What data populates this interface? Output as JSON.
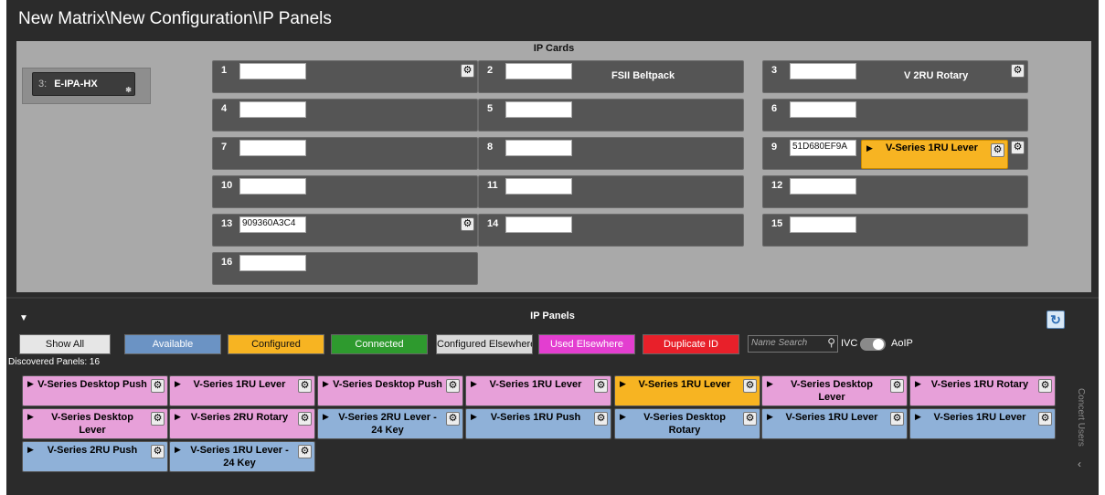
{
  "window": {
    "title": "New Matrix\\New Configuration\\IP Panels"
  },
  "ip_cards": {
    "label": "IP Cards",
    "chassis": {
      "index": "3:",
      "name": "E-IPA-HX"
    },
    "slots": [
      {
        "num": "1",
        "value": "",
        "gear": true,
        "panel_type": ""
      },
      {
        "num": "2",
        "value": "",
        "gear": false,
        "panel_type": "FSII Beltpack"
      },
      {
        "num": "3",
        "value": "",
        "gear": true,
        "panel_type": "V 2RU Rotary"
      },
      {
        "num": "4",
        "value": "",
        "gear": false,
        "panel_type": ""
      },
      {
        "num": "5",
        "value": "",
        "gear": false,
        "panel_type": ""
      },
      {
        "num": "6",
        "value": "",
        "gear": false,
        "panel_type": ""
      },
      {
        "num": "7",
        "value": "",
        "gear": false,
        "panel_type": ""
      },
      {
        "num": "8",
        "value": "",
        "gear": false,
        "panel_type": ""
      },
      {
        "num": "9",
        "value": "51D680EF9A",
        "gear": true,
        "panel_type": "",
        "assigned": {
          "label": "V-Series 1RU Lever",
          "color": "#f7b422"
        }
      },
      {
        "num": "10",
        "value": "",
        "gear": false,
        "panel_type": ""
      },
      {
        "num": "11",
        "value": "",
        "gear": false,
        "panel_type": ""
      },
      {
        "num": "12",
        "value": "",
        "gear": false,
        "panel_type": ""
      },
      {
        "num": "13",
        "value": "909360A3C4",
        "gear": true,
        "panel_type": ""
      },
      {
        "num": "14",
        "value": "",
        "gear": false,
        "panel_type": ""
      },
      {
        "num": "15",
        "value": "",
        "gear": false,
        "panel_type": ""
      },
      {
        "num": "16",
        "value": "",
        "gear": false,
        "panel_type": ""
      }
    ]
  },
  "ip_panels": {
    "label": "IP Panels",
    "filters": [
      {
        "label": "Show All",
        "bg": "#e6e6e6",
        "fg": "#111111"
      },
      {
        "label": "Available",
        "bg": "#6b93c4",
        "fg": "#ffffff"
      },
      {
        "label": "Configured",
        "bg": "#f7b422",
        "fg": "#111111"
      },
      {
        "label": "Connected",
        "bg": "#2e9a2e",
        "fg": "#ffffff"
      },
      {
        "label": "Configured Elsewhere",
        "bg": "#d9d9d9",
        "fg": "#111111"
      },
      {
        "label": "Used Elsewhere",
        "bg": "#e33ed0",
        "fg": "#ffffff"
      },
      {
        "label": "Duplicate ID",
        "bg": "#e8202a",
        "fg": "#ffffff"
      }
    ],
    "search": {
      "placeholder": "Name Search"
    },
    "ivc_label": "IVC",
    "aoip_label": "AoIP",
    "discovered_label": "Discovered Panels: 16",
    "concert_users_label": "Concert Users",
    "panels": [
      {
        "label": "V-Series Desktop Push",
        "color": "#e7a0d9"
      },
      {
        "label": "V-Series 1RU Lever",
        "color": "#e7a0d9"
      },
      {
        "label": "V-Series Desktop Push",
        "color": "#e7a0d9"
      },
      {
        "label": "V-Series 1RU Lever",
        "color": "#e7a0d9"
      },
      {
        "label": "V-Series 1RU Lever",
        "color": "#f7b422"
      },
      {
        "label": "V-Series Desktop Lever",
        "color": "#e7a0d9"
      },
      {
        "label": "V-Series 1RU Rotary",
        "color": "#e7a0d9"
      },
      {
        "label": "V-Series Desktop Lever",
        "color": "#e7a0d9"
      },
      {
        "label": "V-Series 2RU Rotary",
        "color": "#e7a0d9"
      },
      {
        "label": "V-Series 2RU Lever - 24 Key",
        "color": "#8fb1d8"
      },
      {
        "label": "V-Series 1RU Push",
        "color": "#8fb1d8"
      },
      {
        "label": "V-Series Desktop Rotary",
        "color": "#8fb1d8"
      },
      {
        "label": "V-Series 1RU Lever",
        "color": "#8fb1d8"
      },
      {
        "label": "V-Series 1RU Lever",
        "color": "#8fb1d8"
      },
      {
        "label": "V-Series 2RU Push",
        "color": "#8fb1d8"
      },
      {
        "label": "V-Series 1RU Lever - 24 Key",
        "color": "#8fb1d8"
      }
    ]
  }
}
